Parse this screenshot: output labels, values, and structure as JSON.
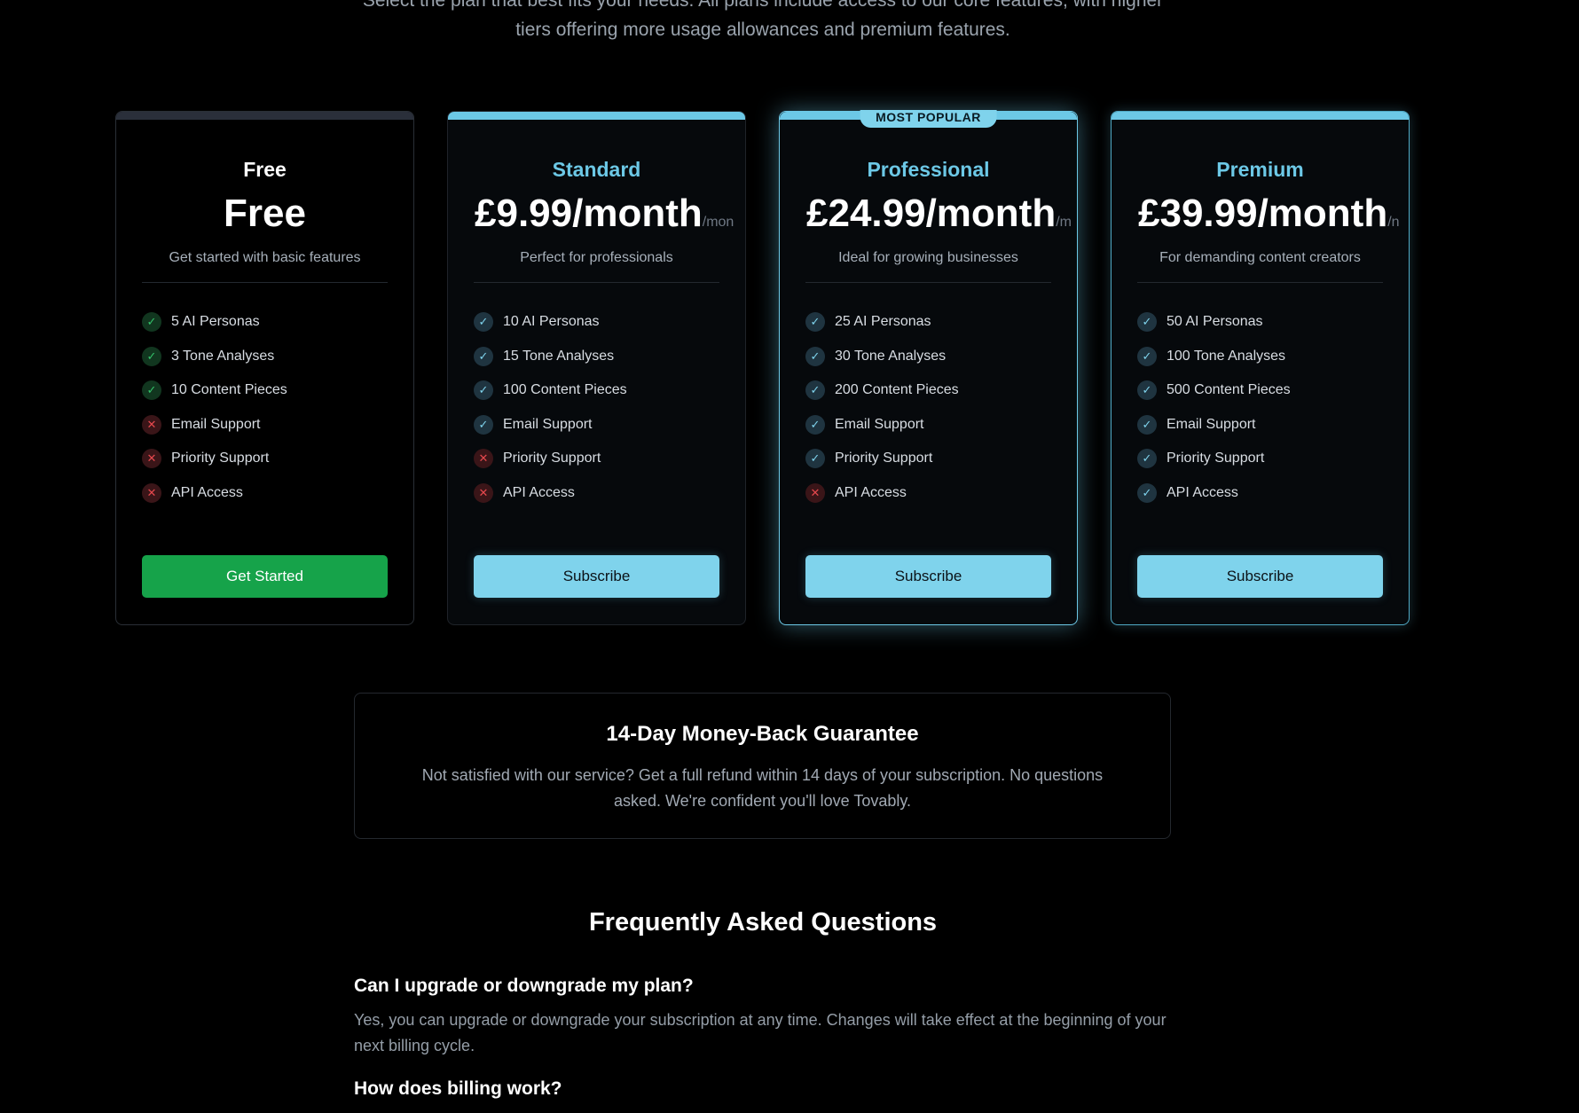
{
  "intro": {
    "line1": "Select the plan that best fits your needs. All plans include access to our core features, with higher",
    "line2": "tiers offering more usage allowances and premium features."
  },
  "plans": [
    {
      "name": "Free",
      "price": "Free",
      "per": "",
      "description": "Get started with basic features",
      "features": [
        {
          "label": "5 AI Personas",
          "included": true,
          "icon": "check-icon"
        },
        {
          "label": "3 Tone Analyses",
          "included": true,
          "icon": "check-icon"
        },
        {
          "label": "10 Content Pieces",
          "included": true,
          "icon": "check-icon"
        },
        {
          "label": "Email Support",
          "included": false,
          "icon": "x-icon"
        },
        {
          "label": "Priority Support",
          "included": false,
          "icon": "x-icon"
        },
        {
          "label": "API Access",
          "included": false,
          "icon": "x-icon"
        }
      ],
      "cta": "Get Started"
    },
    {
      "name": "Standard",
      "price": "£9.99/month",
      "per": "/mon",
      "description": "Perfect for professionals",
      "features": [
        {
          "label": "10 AI Personas",
          "included": true,
          "icon": "check-icon"
        },
        {
          "label": "15 Tone Analyses",
          "included": true,
          "icon": "check-icon"
        },
        {
          "label": "100 Content Pieces",
          "included": true,
          "icon": "check-icon"
        },
        {
          "label": "Email Support",
          "included": true,
          "icon": "check-icon"
        },
        {
          "label": "Priority Support",
          "included": false,
          "icon": "x-icon"
        },
        {
          "label": "API Access",
          "included": false,
          "icon": "x-icon"
        }
      ],
      "cta": "Subscribe"
    },
    {
      "name": "Professional",
      "badge": "MOST POPULAR",
      "price": "£24.99/month",
      "per": "/m",
      "description": "Ideal for growing businesses",
      "features": [
        {
          "label": "25 AI Personas",
          "included": true,
          "icon": "check-icon"
        },
        {
          "label": "30 Tone Analyses",
          "included": true,
          "icon": "check-icon"
        },
        {
          "label": "200 Content Pieces",
          "included": true,
          "icon": "check-icon"
        },
        {
          "label": "Email Support",
          "included": true,
          "icon": "check-icon"
        },
        {
          "label": "Priority Support",
          "included": true,
          "icon": "check-icon"
        },
        {
          "label": "API Access",
          "included": false,
          "icon": "x-icon"
        }
      ],
      "cta": "Subscribe"
    },
    {
      "name": "Premium",
      "price": "£39.99/month",
      "per": "/n",
      "description": "For demanding content creators",
      "features": [
        {
          "label": "50 AI Personas",
          "included": true,
          "icon": "check-icon"
        },
        {
          "label": "100 Tone Analyses",
          "included": true,
          "icon": "check-icon"
        },
        {
          "label": "500 Content Pieces",
          "included": true,
          "icon": "check-icon"
        },
        {
          "label": "Email Support",
          "included": true,
          "icon": "check-icon"
        },
        {
          "label": "Priority Support",
          "included": true,
          "icon": "check-icon"
        },
        {
          "label": "API Access",
          "included": true,
          "icon": "check-icon"
        }
      ],
      "cta": "Subscribe"
    }
  ],
  "guarantee": {
    "title": "14-Day Money-Back Guarantee",
    "text": "Not satisfied with our service? Get a full refund within 14 days of your subscription. No questions asked. We're confident you'll love Tovably."
  },
  "faq": {
    "title": "Frequently Asked Questions",
    "items": [
      {
        "question": "Can I upgrade or downgrade my plan?",
        "answer": "Yes, you can upgrade or downgrade your subscription at any time. Changes will take effect at the beginning of your next billing cycle."
      },
      {
        "question": "How does billing work?",
        "answer": ""
      }
    ]
  },
  "colors": {
    "accent": "#6cc8e6",
    "button": "#7fd3ec",
    "free_button": "#16a34a",
    "check_free": "#34c26a",
    "cross": "#e5484d",
    "background": "#000000"
  }
}
